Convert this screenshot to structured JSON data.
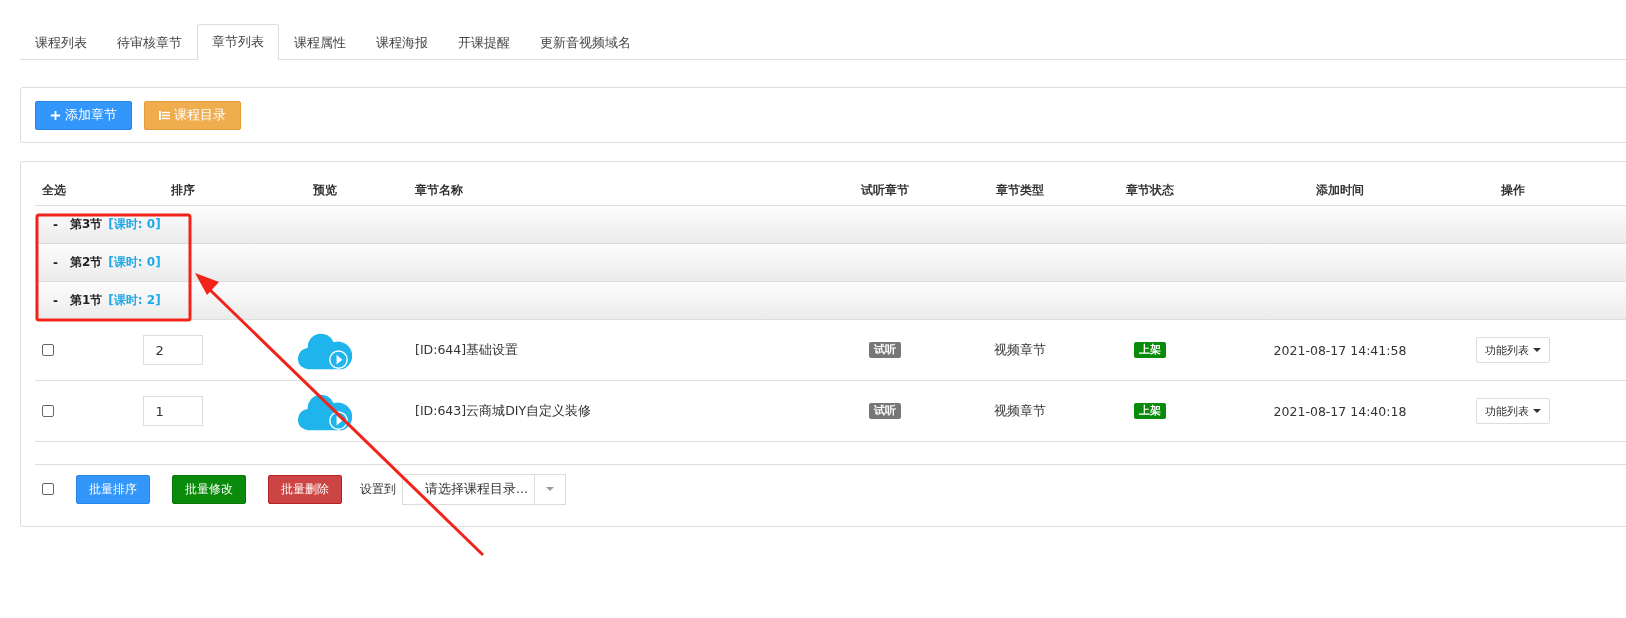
{
  "tabs": [
    {
      "label": "课程列表",
      "selected": false
    },
    {
      "label": "待审核章节",
      "selected": false
    },
    {
      "label": "章节列表",
      "selected": true
    },
    {
      "label": "课程属性",
      "selected": false
    },
    {
      "label": "课程海报",
      "selected": false
    },
    {
      "label": "开课提醒",
      "selected": false
    },
    {
      "label": "更新音视频域名",
      "selected": false
    }
  ],
  "toolbar": [
    {
      "label": "添加章节",
      "kind": "primary"
    },
    {
      "label": "课程目录",
      "kind": "warning"
    }
  ],
  "table": {
    "columns": [
      "全选",
      "排序",
      "预览",
      "章节名称",
      "试听章节",
      "章节类型",
      "章节状态",
      "添加时间",
      "操作"
    ],
    "groups": [
      {
        "toggle": "-",
        "name": "第3节",
        "hours": "[课时: 0]"
      },
      {
        "toggle": "-",
        "name": "第2节",
        "hours": "[课时: 0]"
      },
      {
        "toggle": "-",
        "name": "第1节",
        "hours": "[课时: 2]"
      }
    ],
    "rows": [
      {
        "checked": false,
        "sort": "2",
        "name": "[ID:644]基础设置",
        "trial": "试听",
        "type": "视频章节",
        "status": "上架",
        "time": "2021-08-17 14:41:58",
        "action": "功能列表"
      },
      {
        "checked": false,
        "sort": "1",
        "name": "[ID:643]云商城DIY自定义装修",
        "trial": "试听",
        "type": "视频章节",
        "status": "上架",
        "time": "2021-08-17 14:40:18",
        "action": "功能列表"
      }
    ]
  },
  "footer": {
    "checked": false,
    "buttons": [
      {
        "label": "批量排序",
        "kind": "primary"
      },
      {
        "label": "批量修改",
        "kind": "success"
      },
      {
        "label": "批量删除",
        "kind": "danger"
      }
    ],
    "set_label": "设置到",
    "select": {
      "placeholder": "请选择课程目录..."
    }
  }
}
